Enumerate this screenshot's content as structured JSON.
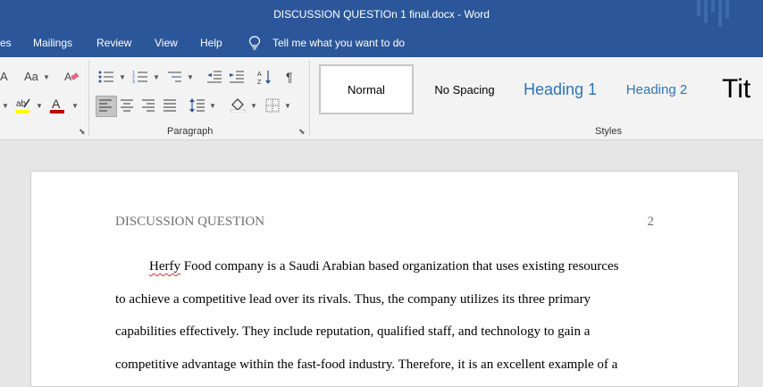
{
  "window": {
    "title": "DISCUSSION QUESTIOn 1 final.docx  -  Word"
  },
  "menu": {
    "tabs": [
      "es",
      "Mailings",
      "Review",
      "View",
      "Help"
    ],
    "tell_me": "Tell me what you want to do"
  },
  "ribbon": {
    "paragraph_label": "Paragraph",
    "styles_label": "Styles",
    "font_size_glyph": "Aa",
    "font_grow_glyph": "A",
    "styles": [
      "Normal",
      "No Spacing",
      "Heading 1",
      "Heading 2",
      "Tit"
    ],
    "colors": {
      "highlight": "#ffff00",
      "font_color": "#c00000"
    }
  },
  "document": {
    "header_title": "DISCUSSION QUESTION",
    "page_number": "2",
    "paragraph": {
      "first_word": "Herfy",
      "line1_rest": " Food company is a Saudi Arabian based organization that uses existing resources",
      "line2": "to achieve a competitive lead over its rivals. Thus, the company utilizes its three primary",
      "line3": "capabilities effectively. They include reputation, qualified staff, and technology to gain a",
      "line4": "competitive advantage within the fast-food industry. Therefore, it is an excellent example of a"
    }
  }
}
